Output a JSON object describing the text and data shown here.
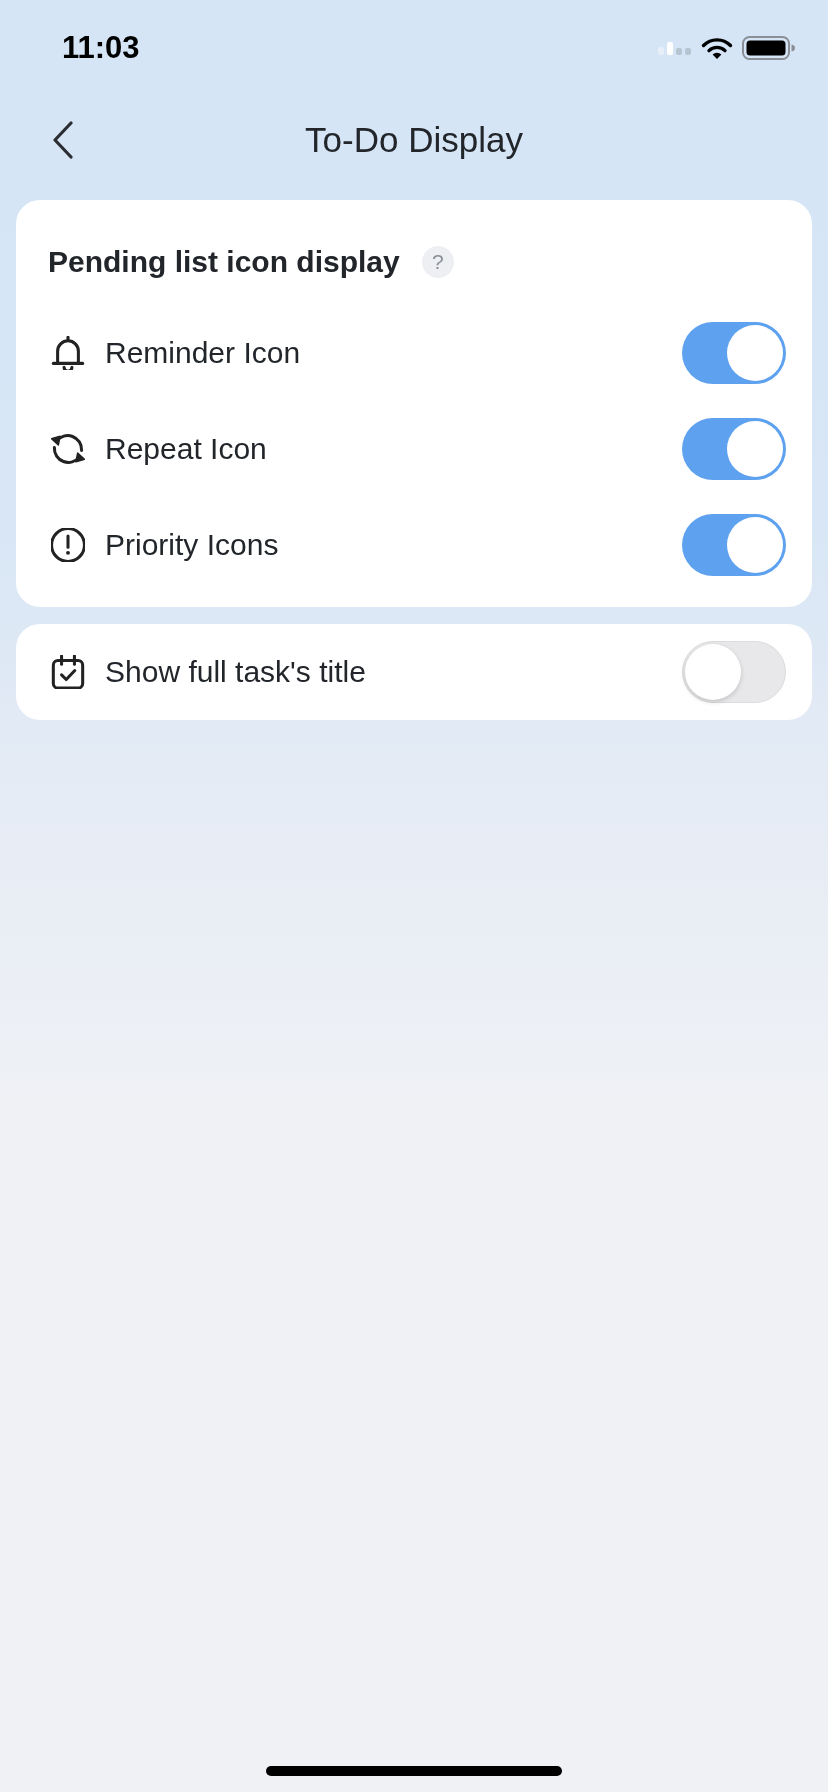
{
  "status_bar": {
    "time": "11:03"
  },
  "header": {
    "title": "To-Do Display"
  },
  "sections": [
    {
      "title": "Pending list icon display",
      "help": "?",
      "rows": [
        {
          "label": "Reminder Icon",
          "on": true
        },
        {
          "label": "Repeat Icon",
          "on": true
        },
        {
          "label": "Priority Icons",
          "on": true
        }
      ]
    },
    {
      "rows": [
        {
          "label": "Show full task's title",
          "on": false
        }
      ]
    }
  ]
}
